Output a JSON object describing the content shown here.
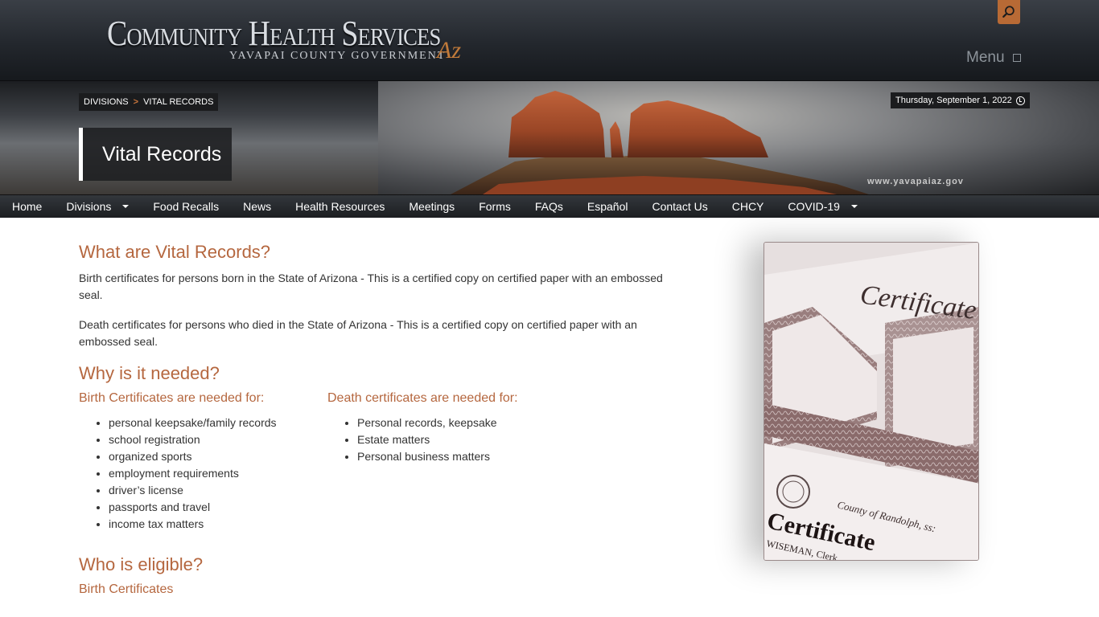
{
  "header": {
    "logo_main": "Community Health Services",
    "logo_sub": "YAVAPAI COUNTY GOVERNMENT",
    "logo_az": "Az",
    "search_icon": "search-icon",
    "menu_label": "Menu"
  },
  "banner": {
    "breadcrumb": [
      "DIVISIONS",
      "VITAL RECORDS"
    ],
    "breadcrumb_sep": ">",
    "date": "Thursday, September 1, 2022",
    "page_title": "Vital Records",
    "watermark": "www.yavapaiaz.gov"
  },
  "nav": [
    {
      "label": "Home",
      "dropdown": false
    },
    {
      "label": "Divisions",
      "dropdown": true
    },
    {
      "label": "Food Recalls",
      "dropdown": false
    },
    {
      "label": "News",
      "dropdown": false
    },
    {
      "label": "Health Resources",
      "dropdown": false
    },
    {
      "label": "Meetings",
      "dropdown": false
    },
    {
      "label": "Forms",
      "dropdown": false
    },
    {
      "label": "FAQs",
      "dropdown": false
    },
    {
      "label": "Español",
      "dropdown": false
    },
    {
      "label": "Contact Us",
      "dropdown": false
    },
    {
      "label": "CHCY",
      "dropdown": false
    },
    {
      "label": "COVID-19",
      "dropdown": true
    }
  ],
  "content": {
    "what_heading": "What are Vital Records?",
    "what_p1": "Birth certificates for persons born in the State of Arizona - This is a certified copy on certified paper with an embossed seal.",
    "what_p2": "Death certificates for persons who died in the State of Arizona - This is a certified copy on certified paper with an embossed seal.",
    "why_heading": "Why is it needed?",
    "birth_col_heading": "Birth Certificates are needed for:",
    "birth_items": [
      "personal keepsake/family records",
      "school registration",
      "organized sports",
      "employment requirements",
      "driver’s license",
      "passports and travel",
      "income tax matters"
    ],
    "death_col_heading": "Death certificates are needed for:",
    "death_items": [
      "Personal records, keepsake",
      "Estate matters",
      "Personal business matters"
    ],
    "eligible_heading": "Who is eligible?",
    "eligible_sub": "Birth Certificates"
  },
  "photo": {
    "text_large": "Certificate",
    "text_county": "County of Randolph, ss:",
    "text_bottom": "Certificate",
    "text_name": "WISEMAN, Clerk"
  },
  "colors": {
    "accent": "#b5673f",
    "nav_bg": "#1c1e21",
    "search_bg": "#b86a35"
  }
}
